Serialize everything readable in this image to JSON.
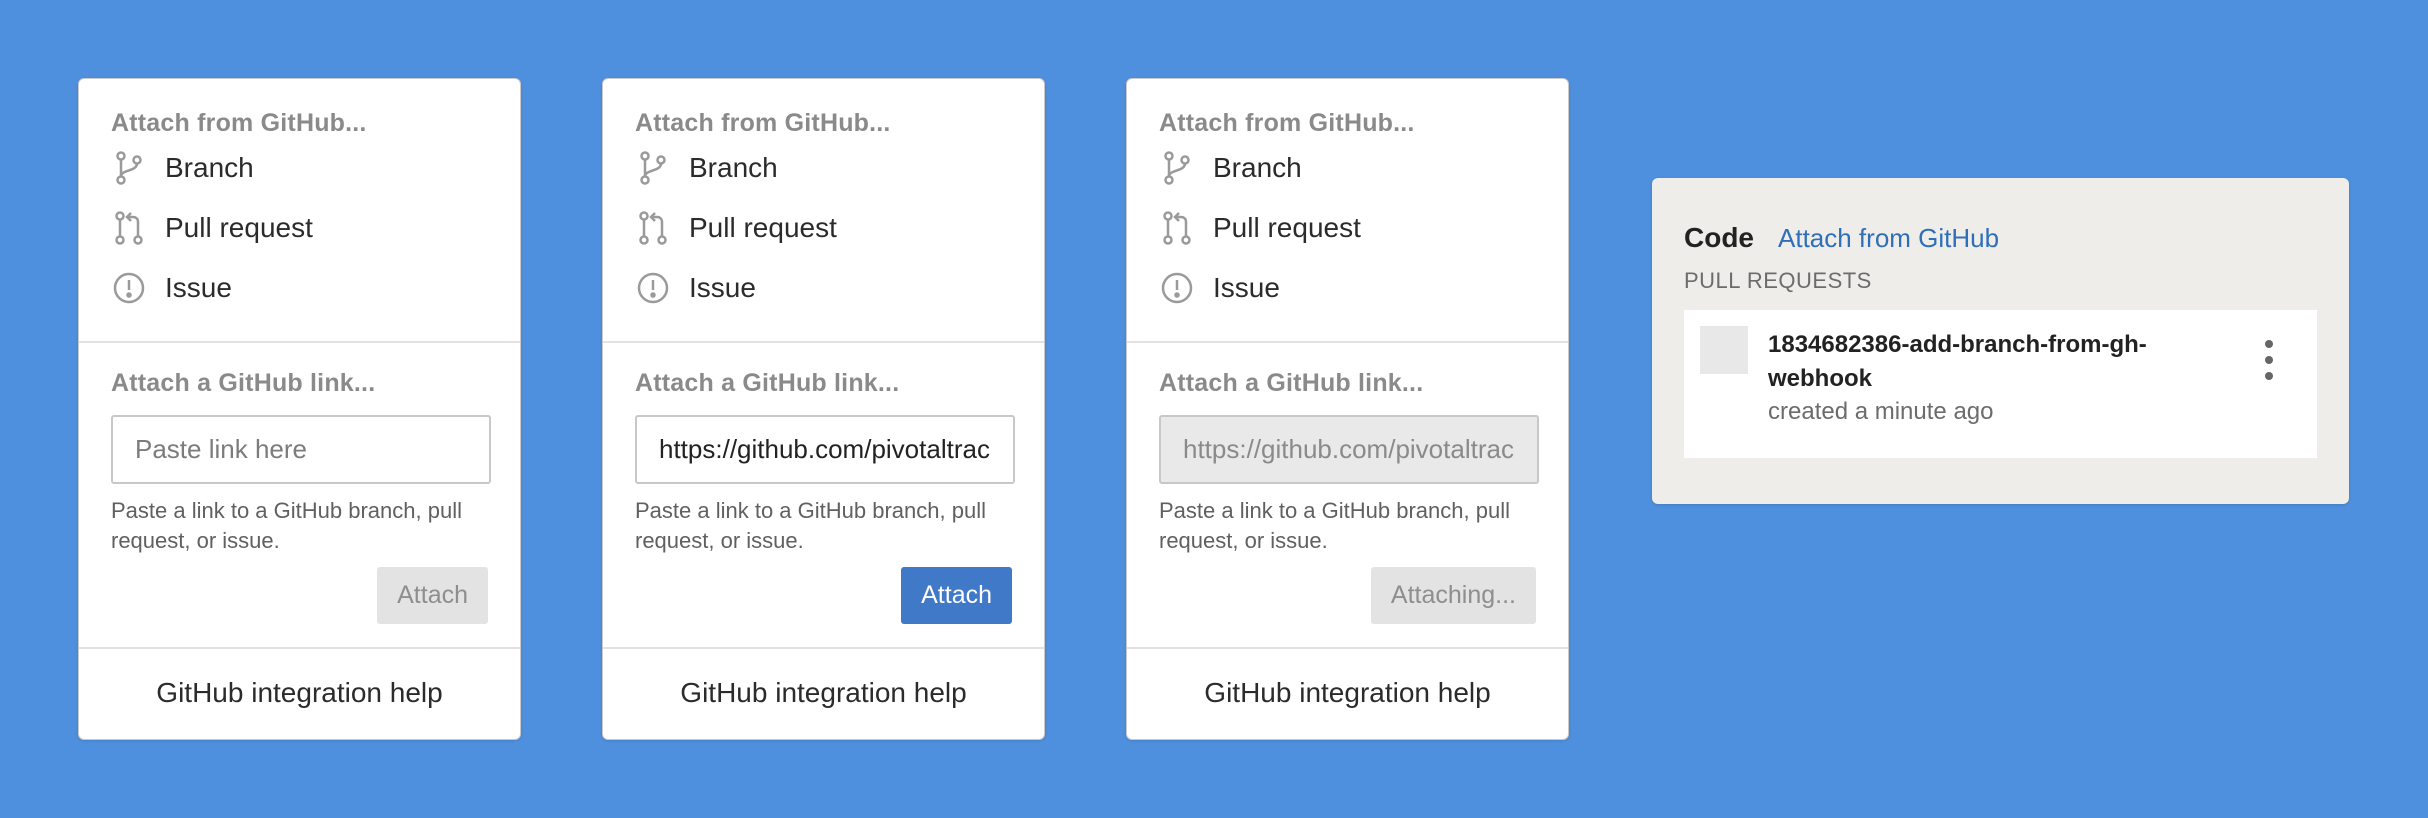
{
  "panels": [
    {
      "heading": "Attach from GitHub...",
      "options": {
        "branch": "Branch",
        "pull_request": "Pull request",
        "issue": "Issue"
      },
      "link_heading": "Attach a GitHub link...",
      "input_value": "",
      "input_placeholder": "Paste link here",
      "hint": "Paste a link to a GitHub branch, pull request, or issue.",
      "button": "Attach",
      "help": "GitHub integration help"
    },
    {
      "heading": "Attach from GitHub...",
      "options": {
        "branch": "Branch",
        "pull_request": "Pull request",
        "issue": "Issue"
      },
      "link_heading": "Attach a GitHub link...",
      "input_value": "https://github.com/pivotaltrack",
      "input_placeholder": "",
      "hint": "Paste a link to a GitHub branch, pull request, or issue.",
      "button": "Attach",
      "help": "GitHub integration help"
    },
    {
      "heading": "Attach from GitHub...",
      "options": {
        "branch": "Branch",
        "pull_request": "Pull request",
        "issue": "Issue"
      },
      "link_heading": "Attach a GitHub link...",
      "input_value": "https://github.com/pivotaltrack",
      "input_placeholder": "",
      "hint": "Paste a link to a GitHub branch, pull request, or issue.",
      "button": "Attaching...",
      "help": "GitHub integration help"
    }
  ],
  "code": {
    "title": "Code",
    "attach_link": "Attach from GitHub",
    "section_label": "PULL REQUESTS",
    "pull_request": {
      "name": "1834682386-add-branch-from-gh-webhook",
      "meta": "created a minute ago"
    }
  },
  "colors": {
    "background": "#4f90de",
    "primary_button": "#3f79c7",
    "link": "#2f6fba"
  }
}
